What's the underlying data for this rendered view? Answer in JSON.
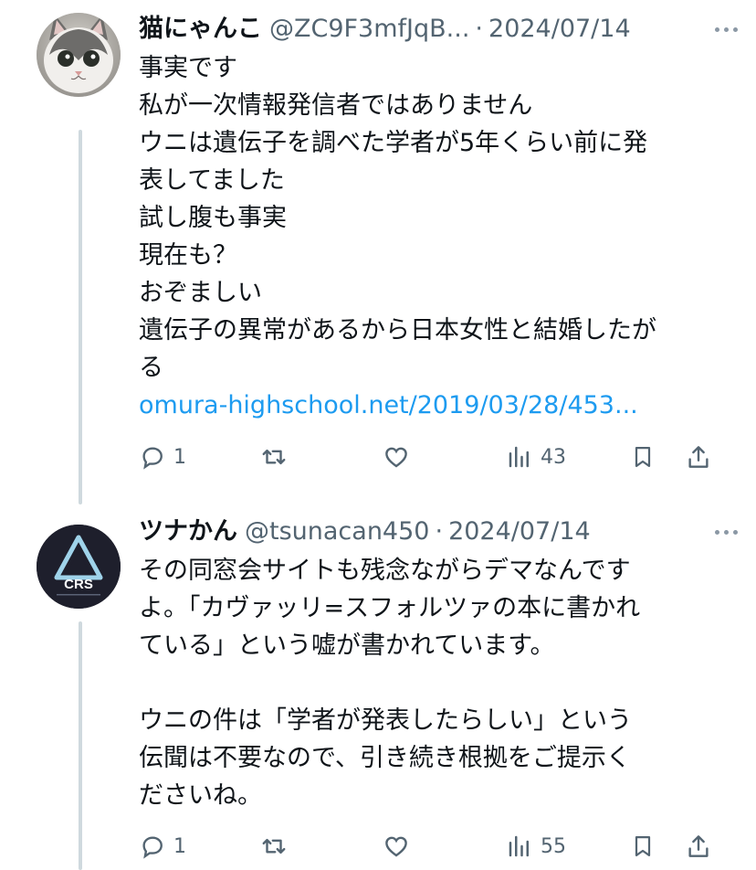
{
  "tweets": [
    {
      "display_name": "猫にゃんこ",
      "handle": "@ZC9F3mfJqB...",
      "separator": "·",
      "date": "2024/07/14",
      "avatar_icon": "cat-avatar-icon",
      "lines": [
        "事実です",
        "私が一次情報発信者ではありません",
        "ウニは遺伝子を調べた学者が5年くらい前に発",
        "表してました",
        "試し腹も事実",
        "現在も？",
        "おぞましい",
        "遺伝子の異常があるから日本女性と結婚したが",
        "る"
      ],
      "link": "omura-highschool.net/2019/03/28/453...",
      "replies": "1",
      "views": "43"
    },
    {
      "display_name": "ツナかん",
      "handle": "@tsunacan450",
      "separator": "·",
      "date": "2024/07/14",
      "avatar_text": "CRS",
      "avatar_icon": "crs-logo-icon",
      "lines": [
        "その同窓会サイトも残念ながらデマなんです",
        "よ。「カヴァッリ=スフォルツァの本に書かれ",
        "ている」という嘘が書かれています。",
        "",
        "ウニの件は「学者が発表したらしい」という",
        "伝聞は不要なので、引き続き根拠をご提示く",
        "ださいね。"
      ],
      "replies": "1",
      "views": "55"
    }
  ],
  "colors": {
    "text": "#0f1419",
    "secondary": "#536471",
    "link": "#1d9bf0",
    "thread_line": "#cfd9de"
  },
  "icons": {
    "reply": "reply-icon",
    "retweet": "retweet-icon",
    "like": "heart-icon",
    "views": "views-icon",
    "bookmark": "bookmark-icon",
    "share": "share-icon",
    "more": "more-icon"
  }
}
